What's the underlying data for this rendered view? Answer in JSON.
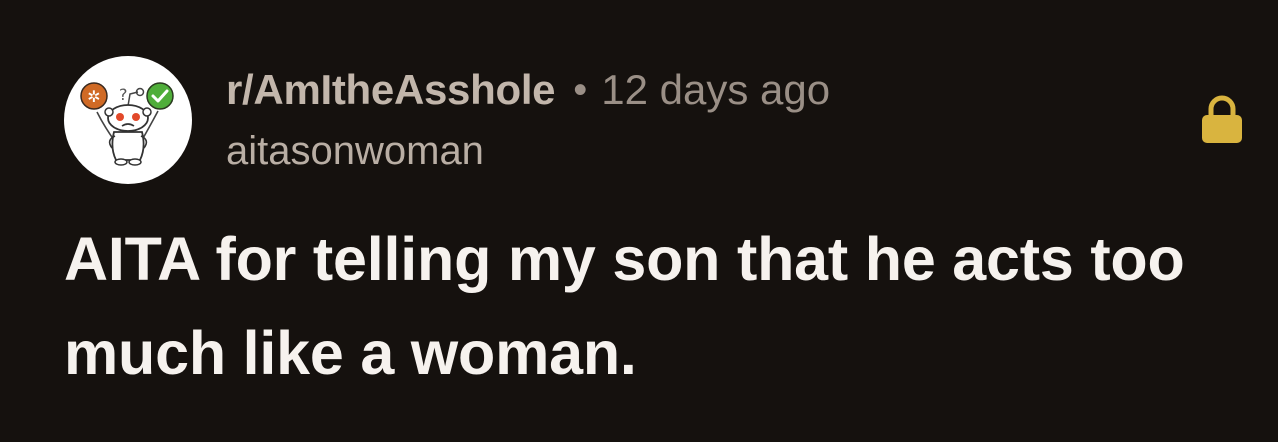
{
  "post": {
    "subreddit": "r/AmItheAsshole",
    "separator": "•",
    "timestamp": "12 days ago",
    "author": "aitasonwoman",
    "title": "AITA for telling my son that he acts too much like a woman."
  },
  "icons": {
    "avatar": "reddit-snoo-balloons-icon",
    "lock": "lock-icon"
  },
  "colors": {
    "background": "#15110e",
    "subreddit_text": "#c2b6ab",
    "meta_text": "#9a8f86",
    "title_text": "#f6f2ee",
    "lock": "#d9b43f",
    "balloon_orange": "#d06a25",
    "balloon_green": "#4fae3a"
  }
}
